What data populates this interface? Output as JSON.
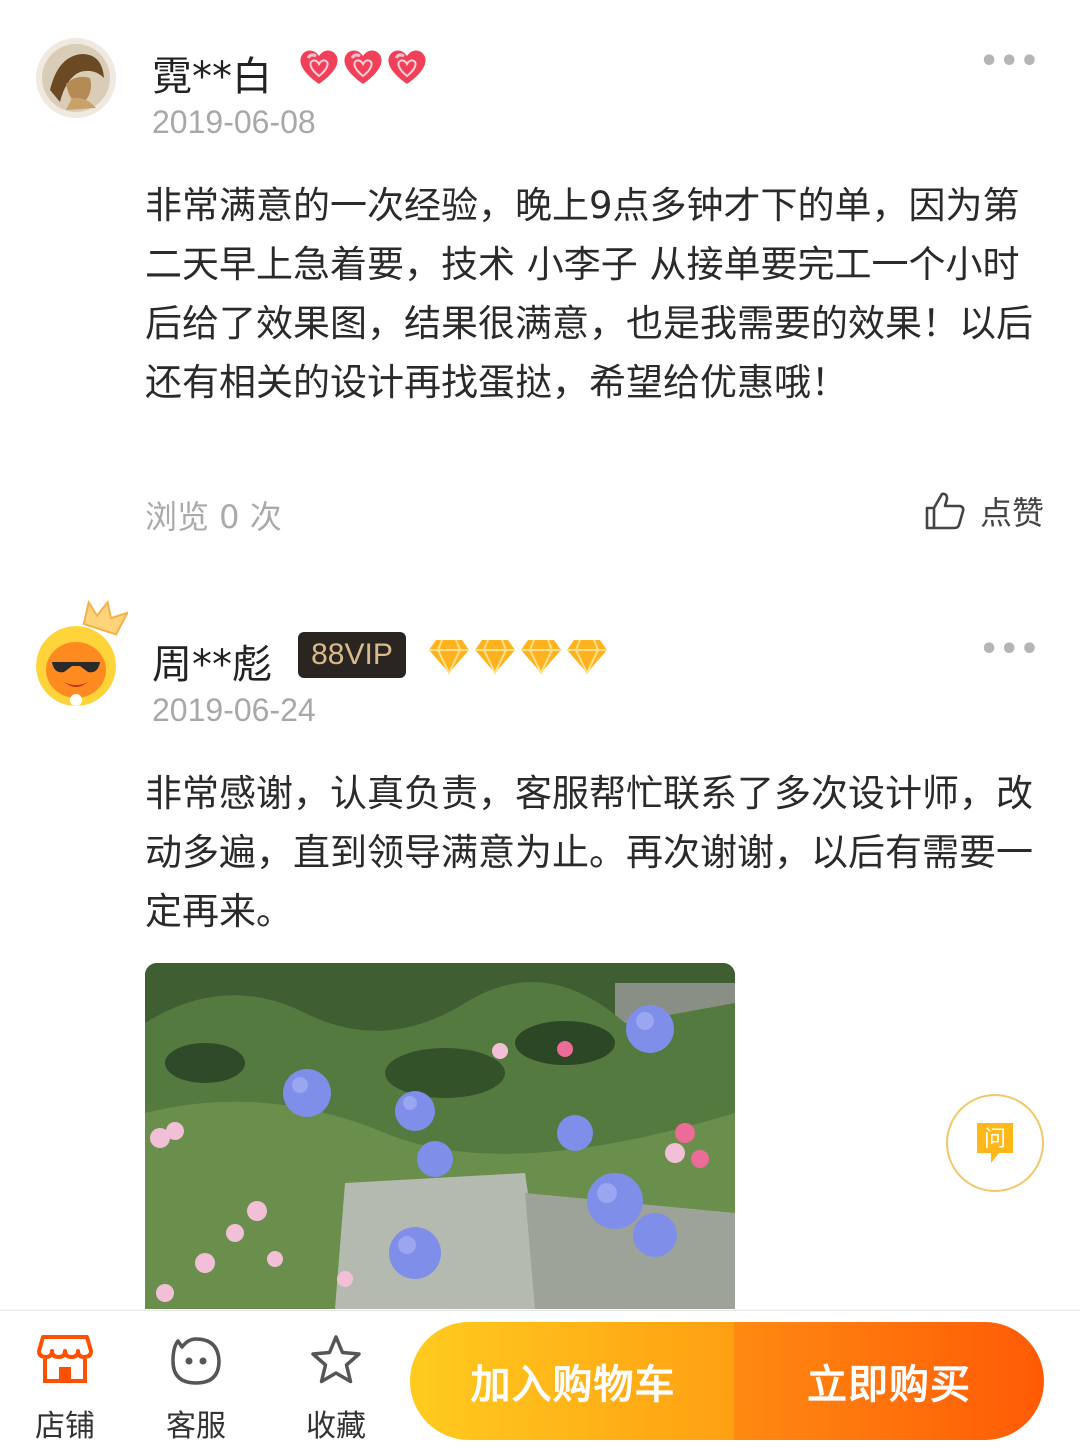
{
  "reviews": [
    {
      "username": "霓**白",
      "date": "2019-06-08",
      "text": "非常满意的一次经验，晚上9点多钟才下的单，因为第二天早上急着要，技术 小李子 从接单要完工一个小时后给了效果图，结果很满意，也是我需要的效果！以后还有相关的设计再找蛋挞，希望给优惠哦！",
      "views": "浏览 0 次",
      "like_label": "点赞",
      "more": "•••",
      "level_icons": [
        "heart-icon",
        "heart-icon",
        "heart-icon"
      ],
      "level_color": "#f0405a"
    },
    {
      "username": "周**彪",
      "date": "2019-06-24",
      "vip_badge": "88VIP",
      "text": "非常感谢，认真负责，客服帮忙联系了多次设计师，改动多遍，直到领导满意为止。再次谢谢，以后有需要一定再来。",
      "more": "•••",
      "level_icons": [
        "diamond-icon",
        "diamond-icon",
        "diamond-icon",
        "diamond-icon"
      ],
      "level_color": "#ffb21e"
    }
  ],
  "floating": {
    "ask_label": "问"
  },
  "bottom_bar": {
    "shop_label": "店铺",
    "service_label": "客服",
    "favorite_label": "收藏",
    "cart_label": "加入购物车",
    "buy_label": "立即购买"
  },
  "colors": {
    "accent_orange": "#ff5a05",
    "cart_yellow": "#ffb516",
    "shop_icon": "#ff5000"
  }
}
